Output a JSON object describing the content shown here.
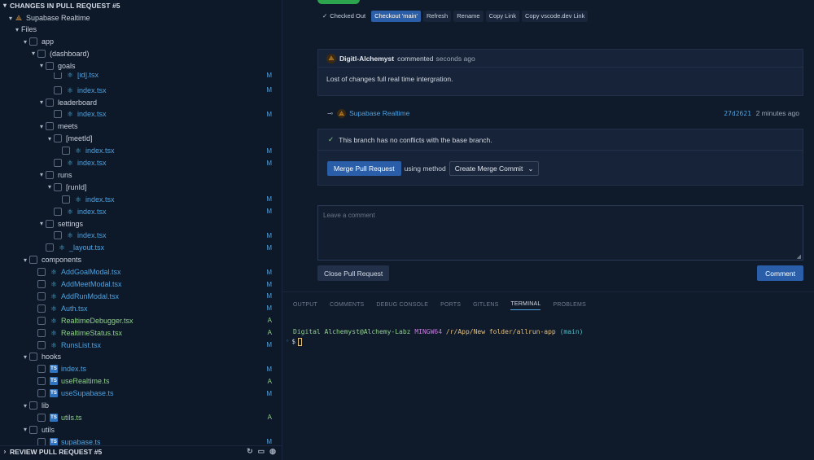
{
  "left_panel": {
    "section_title": "CHANGES IN PULL REQUEST #5",
    "root_label": "Supabase Realtime",
    "files_label": "Files",
    "tree": [
      {
        "label": "app",
        "type": "folder",
        "indent": 1
      },
      {
        "label": "(dashboard)",
        "type": "folder",
        "indent": 2
      },
      {
        "label": "goals",
        "type": "folder",
        "indent": 3
      },
      {
        "label": "[id].tsx",
        "type": "react",
        "indent": 4,
        "status": "M",
        "partial": true
      },
      {
        "label": "index.tsx",
        "type": "react",
        "indent": 4,
        "status": "M"
      },
      {
        "label": "leaderboard",
        "type": "folder",
        "indent": 3
      },
      {
        "label": "index.tsx",
        "type": "react",
        "indent": 4,
        "status": "M"
      },
      {
        "label": "meets",
        "type": "folder",
        "indent": 3
      },
      {
        "label": "[meetId]",
        "type": "folder",
        "indent": 4
      },
      {
        "label": "index.tsx",
        "type": "react",
        "indent": 5,
        "status": "M"
      },
      {
        "label": "index.tsx",
        "type": "react",
        "indent": 4,
        "status": "M"
      },
      {
        "label": "runs",
        "type": "folder",
        "indent": 3
      },
      {
        "label": "[runId]",
        "type": "folder",
        "indent": 4
      },
      {
        "label": "index.tsx",
        "type": "react",
        "indent": 5,
        "status": "M"
      },
      {
        "label": "index.tsx",
        "type": "react",
        "indent": 4,
        "status": "M"
      },
      {
        "label": "settings",
        "type": "folder",
        "indent": 3
      },
      {
        "label": "index.tsx",
        "type": "react",
        "indent": 4,
        "status": "M"
      },
      {
        "label": "_layout.tsx",
        "type": "react",
        "indent": 3,
        "status": "M"
      },
      {
        "label": "components",
        "type": "folder",
        "indent": 1
      },
      {
        "label": "AddGoalModal.tsx",
        "type": "react",
        "indent": 2,
        "status": "M"
      },
      {
        "label": "AddMeetModal.tsx",
        "type": "react",
        "indent": 2,
        "status": "M"
      },
      {
        "label": "AddRunModal.tsx",
        "type": "react",
        "indent": 2,
        "status": "M"
      },
      {
        "label": "Auth.tsx",
        "type": "react",
        "indent": 2,
        "status": "M"
      },
      {
        "label": "RealtimeDebugger.tsx",
        "type": "react",
        "indent": 2,
        "status": "A"
      },
      {
        "label": "RealtimeStatus.tsx",
        "type": "react",
        "indent": 2,
        "status": "A"
      },
      {
        "label": "RunsList.tsx",
        "type": "react",
        "indent": 2,
        "status": "M"
      },
      {
        "label": "hooks",
        "type": "folder",
        "indent": 1
      },
      {
        "label": "index.ts",
        "type": "ts",
        "indent": 2,
        "status": "M"
      },
      {
        "label": "useRealtime.ts",
        "type": "ts",
        "indent": 2,
        "status": "A"
      },
      {
        "label": "useSupabase.ts",
        "type": "ts",
        "indent": 2,
        "status": "M"
      },
      {
        "label": "lib",
        "type": "folder",
        "indent": 1
      },
      {
        "label": "utils.ts",
        "type": "ts",
        "indent": 2,
        "status": "A"
      },
      {
        "label": "utils",
        "type": "folder",
        "indent": 1
      },
      {
        "label": "supabase.ts",
        "type": "ts",
        "indent": 2,
        "status": "M"
      }
    ],
    "bottom_section_title": "REVIEW PULL REQUEST #5"
  },
  "actions": {
    "checked_out": "Checked Out",
    "checkout_main": "Checkout 'main'",
    "refresh": "Refresh",
    "rename": "Rename",
    "copy_link": "Copy Link",
    "copy_vscode_link": "Copy vscode.dev Link"
  },
  "comment": {
    "author": "Digitl-Alchemyst",
    "verb": "commented",
    "time": "seconds ago",
    "body": "Lost of changes full real time intergration."
  },
  "commit": {
    "title": "Supabase Realtime",
    "sha": "27d2621",
    "time": "2 minutes ago"
  },
  "merge": {
    "status": "This branch has no conflicts with the base branch.",
    "button": "Merge Pull Request",
    "using": "using method",
    "method": "Create Merge Commit"
  },
  "comment_box": {
    "placeholder": "Leave a comment",
    "close_button": "Close Pull Request",
    "comment_button": "Comment"
  },
  "panel": {
    "tabs": [
      "OUTPUT",
      "COMMENTS",
      "DEBUG CONSOLE",
      "PORTS",
      "GITLENS",
      "TERMINAL",
      "PROBLEMS"
    ],
    "active_tab": "TERMINAL",
    "terminal": {
      "user": "Digital Alchemyst@Alchemy-Labz",
      "env": "MINGW64",
      "path": "/r/App/New folder/allrun-app",
      "branch": "(main)",
      "prompt": "$"
    }
  },
  "colors": {
    "accent": "#2a5ea8",
    "modified": "#4fa3e0",
    "added": "#8fd18a"
  }
}
